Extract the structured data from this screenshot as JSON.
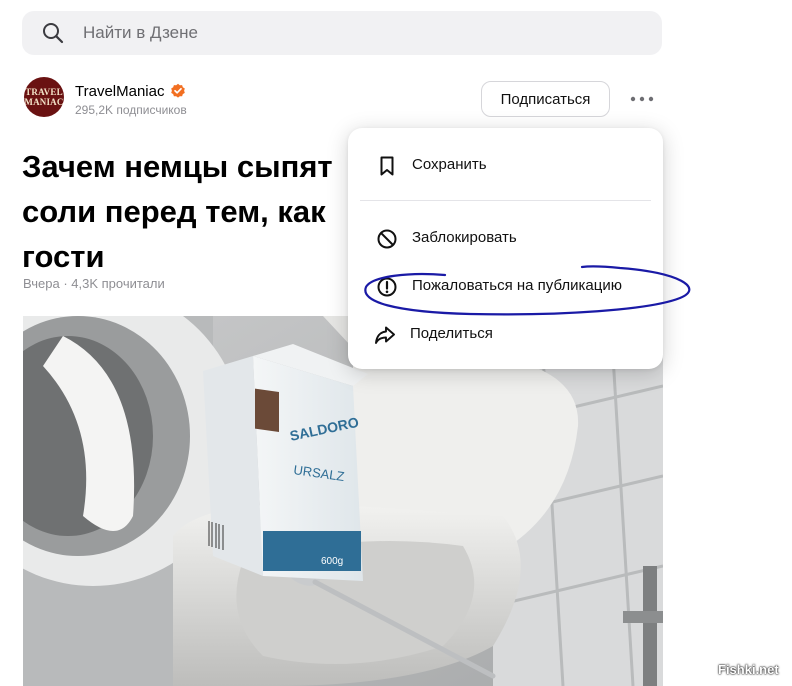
{
  "search": {
    "placeholder": "Найти в Дзене",
    "icon": "search-icon"
  },
  "channel": {
    "avatar_text": [
      "TRAVEL",
      "MANIAC"
    ],
    "name": "TravelManiac",
    "subscribers": "295,2K подписчиков",
    "verified_color": "#f26f21",
    "subscribe_label": "Подписаться"
  },
  "article": {
    "title": "Зачем немцы сыпят соли перед тем, как гости",
    "title_lines": [
      "Зачем немцы сыпят",
      "соли перед тем, как",
      "гости"
    ],
    "meta": "Вчера · 4,3K прочитали"
  },
  "photo_labels": {
    "brand": "SALDORO",
    "product": "URSALZ",
    "weight": "600g"
  },
  "menu": {
    "items": [
      {
        "label": "Сохранить",
        "icon": "bookmark-icon"
      },
      {
        "label": "Заблокировать",
        "icon": "block-icon"
      },
      {
        "label": "Пожаловаться на публикацию",
        "icon": "report-icon"
      },
      {
        "label": "Поделиться",
        "icon": "share-icon"
      }
    ]
  },
  "annotation": {
    "color": "#1a1aa6"
  },
  "watermark": "Fishki.net"
}
